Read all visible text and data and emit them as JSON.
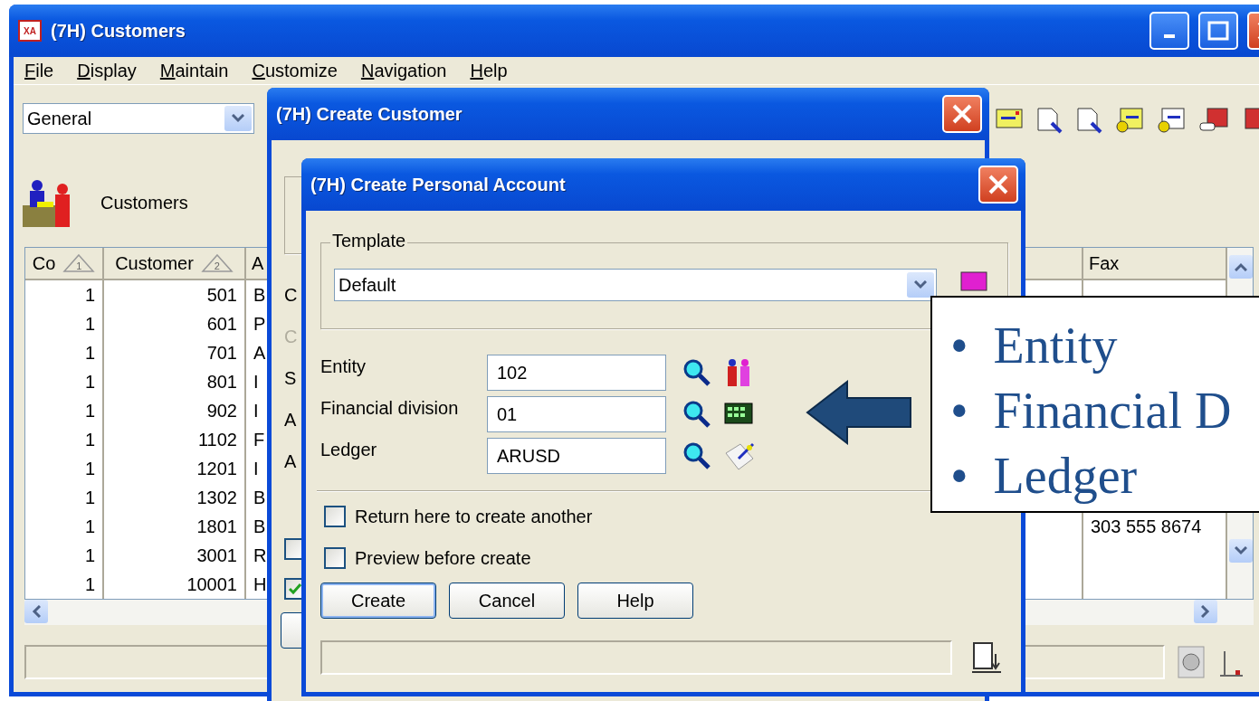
{
  "main_window": {
    "app_icon_text": "XA",
    "title": "(7H) Customers",
    "menu": [
      "File",
      "Display",
      "Maintain",
      "Customize",
      "Navigation",
      "Help"
    ],
    "view_select": {
      "value": "General"
    },
    "header_label": "Customers",
    "table": {
      "columns": [
        {
          "label": "Co",
          "sort": "1"
        },
        {
          "label": "Customer",
          "sort": "2"
        },
        {
          "label": "A"
        },
        {
          "label": "Fax"
        }
      ],
      "rows": [
        {
          "co": "1",
          "customer": "501",
          "column_3": "B"
        },
        {
          "co": "1",
          "customer": "601",
          "column_3": "P"
        },
        {
          "co": "1",
          "customer": "701",
          "column_3": "A"
        },
        {
          "co": "1",
          "customer": "801",
          "column_3": "I"
        },
        {
          "co": "1",
          "customer": "902",
          "column_3": "I"
        },
        {
          "co": "1",
          "customer": "1102",
          "column_3": "F"
        },
        {
          "co": "1",
          "customer": "1201",
          "column_3": "I"
        },
        {
          "co": "1",
          "customer": "1302",
          "column_3": "B"
        },
        {
          "co": "1",
          "customer": "1801",
          "column_3": "B",
          "fax": "303 555 8674"
        },
        {
          "co": "1",
          "customer": "3001",
          "column_3": "R"
        },
        {
          "co": "1",
          "customer": "10001",
          "column_3": "H"
        }
      ]
    }
  },
  "create_customer_dialog": {
    "title": "(7H) Create Customer",
    "labels": [
      {
        "text": "C",
        "disabled": false
      },
      {
        "text": "C",
        "disabled": true
      },
      {
        "text": "S",
        "disabled": false
      },
      {
        "text": "A",
        "disabled": false
      },
      {
        "text": "A",
        "disabled": false
      }
    ],
    "checkboxes": [
      {
        "checked": false
      },
      {
        "checked": true
      }
    ]
  },
  "personal_account_dialog": {
    "title": "(7H) Create Personal Account",
    "template": {
      "legend": "Template",
      "value": "Default"
    },
    "fields": [
      {
        "label": "Entity",
        "value": "102",
        "kind": "entity"
      },
      {
        "label": "Financial division",
        "value": "01",
        "kind": "division"
      },
      {
        "label": "Ledger",
        "value": "ARUSD",
        "kind": "ledger"
      }
    ],
    "options": [
      {
        "label": "Return here to create another",
        "checked": false
      },
      {
        "label": "Preview before create",
        "checked": false
      }
    ],
    "buttons": [
      {
        "label": "Create",
        "default": true
      },
      {
        "label": "Cancel",
        "default": false
      },
      {
        "label": "Help",
        "default": false
      }
    ]
  },
  "callout": {
    "bullets": [
      {
        "marker": "•",
        "text": "Entity"
      },
      {
        "marker": "•",
        "text": "Financial D"
      },
      {
        "marker": "•",
        "text": "Ledger"
      }
    ]
  }
}
